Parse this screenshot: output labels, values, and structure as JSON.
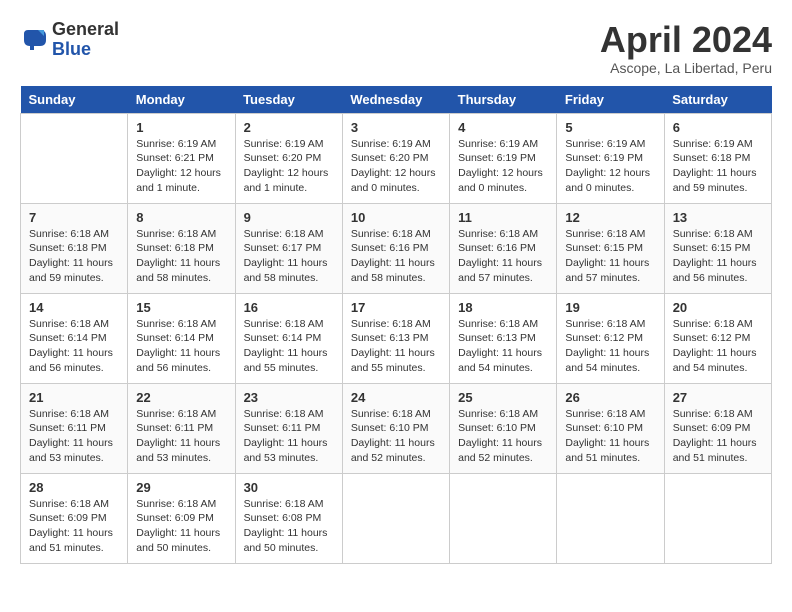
{
  "logo": {
    "general": "General",
    "blue": "Blue"
  },
  "title": "April 2024",
  "location": "Ascope, La Libertad, Peru",
  "days_of_week": [
    "Sunday",
    "Monday",
    "Tuesday",
    "Wednesday",
    "Thursday",
    "Friday",
    "Saturday"
  ],
  "weeks": [
    [
      {
        "day": "",
        "info": ""
      },
      {
        "day": "1",
        "info": "Sunrise: 6:19 AM\nSunset: 6:21 PM\nDaylight: 12 hours\nand 1 minute."
      },
      {
        "day": "2",
        "info": "Sunrise: 6:19 AM\nSunset: 6:20 PM\nDaylight: 12 hours\nand 1 minute."
      },
      {
        "day": "3",
        "info": "Sunrise: 6:19 AM\nSunset: 6:20 PM\nDaylight: 12 hours\nand 0 minutes."
      },
      {
        "day": "4",
        "info": "Sunrise: 6:19 AM\nSunset: 6:19 PM\nDaylight: 12 hours\nand 0 minutes."
      },
      {
        "day": "5",
        "info": "Sunrise: 6:19 AM\nSunset: 6:19 PM\nDaylight: 12 hours\nand 0 minutes."
      },
      {
        "day": "6",
        "info": "Sunrise: 6:19 AM\nSunset: 6:18 PM\nDaylight: 11 hours\nand 59 minutes."
      }
    ],
    [
      {
        "day": "7",
        "info": "Sunrise: 6:18 AM\nSunset: 6:18 PM\nDaylight: 11 hours\nand 59 minutes."
      },
      {
        "day": "8",
        "info": "Sunrise: 6:18 AM\nSunset: 6:18 PM\nDaylight: 11 hours\nand 58 minutes."
      },
      {
        "day": "9",
        "info": "Sunrise: 6:18 AM\nSunset: 6:17 PM\nDaylight: 11 hours\nand 58 minutes."
      },
      {
        "day": "10",
        "info": "Sunrise: 6:18 AM\nSunset: 6:16 PM\nDaylight: 11 hours\nand 58 minutes."
      },
      {
        "day": "11",
        "info": "Sunrise: 6:18 AM\nSunset: 6:16 PM\nDaylight: 11 hours\nand 57 minutes."
      },
      {
        "day": "12",
        "info": "Sunrise: 6:18 AM\nSunset: 6:15 PM\nDaylight: 11 hours\nand 57 minutes."
      },
      {
        "day": "13",
        "info": "Sunrise: 6:18 AM\nSunset: 6:15 PM\nDaylight: 11 hours\nand 56 minutes."
      }
    ],
    [
      {
        "day": "14",
        "info": "Sunrise: 6:18 AM\nSunset: 6:14 PM\nDaylight: 11 hours\nand 56 minutes."
      },
      {
        "day": "15",
        "info": "Sunrise: 6:18 AM\nSunset: 6:14 PM\nDaylight: 11 hours\nand 56 minutes."
      },
      {
        "day": "16",
        "info": "Sunrise: 6:18 AM\nSunset: 6:14 PM\nDaylight: 11 hours\nand 55 minutes."
      },
      {
        "day": "17",
        "info": "Sunrise: 6:18 AM\nSunset: 6:13 PM\nDaylight: 11 hours\nand 55 minutes."
      },
      {
        "day": "18",
        "info": "Sunrise: 6:18 AM\nSunset: 6:13 PM\nDaylight: 11 hours\nand 54 minutes."
      },
      {
        "day": "19",
        "info": "Sunrise: 6:18 AM\nSunset: 6:12 PM\nDaylight: 11 hours\nand 54 minutes."
      },
      {
        "day": "20",
        "info": "Sunrise: 6:18 AM\nSunset: 6:12 PM\nDaylight: 11 hours\nand 54 minutes."
      }
    ],
    [
      {
        "day": "21",
        "info": "Sunrise: 6:18 AM\nSunset: 6:11 PM\nDaylight: 11 hours\nand 53 minutes."
      },
      {
        "day": "22",
        "info": "Sunrise: 6:18 AM\nSunset: 6:11 PM\nDaylight: 11 hours\nand 53 minutes."
      },
      {
        "day": "23",
        "info": "Sunrise: 6:18 AM\nSunset: 6:11 PM\nDaylight: 11 hours\nand 53 minutes."
      },
      {
        "day": "24",
        "info": "Sunrise: 6:18 AM\nSunset: 6:10 PM\nDaylight: 11 hours\nand 52 minutes."
      },
      {
        "day": "25",
        "info": "Sunrise: 6:18 AM\nSunset: 6:10 PM\nDaylight: 11 hours\nand 52 minutes."
      },
      {
        "day": "26",
        "info": "Sunrise: 6:18 AM\nSunset: 6:10 PM\nDaylight: 11 hours\nand 51 minutes."
      },
      {
        "day": "27",
        "info": "Sunrise: 6:18 AM\nSunset: 6:09 PM\nDaylight: 11 hours\nand 51 minutes."
      }
    ],
    [
      {
        "day": "28",
        "info": "Sunrise: 6:18 AM\nSunset: 6:09 PM\nDaylight: 11 hours\nand 51 minutes."
      },
      {
        "day": "29",
        "info": "Sunrise: 6:18 AM\nSunset: 6:09 PM\nDaylight: 11 hours\nand 50 minutes."
      },
      {
        "day": "30",
        "info": "Sunrise: 6:18 AM\nSunset: 6:08 PM\nDaylight: 11 hours\nand 50 minutes."
      },
      {
        "day": "",
        "info": ""
      },
      {
        "day": "",
        "info": ""
      },
      {
        "day": "",
        "info": ""
      },
      {
        "day": "",
        "info": ""
      }
    ]
  ]
}
